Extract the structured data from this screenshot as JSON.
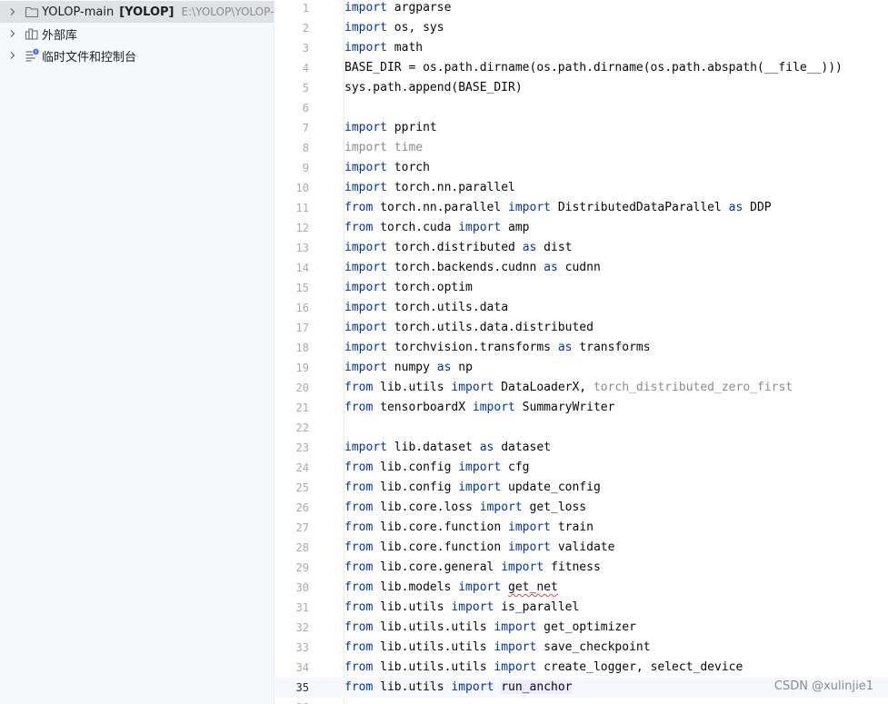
{
  "tree": {
    "items": [
      {
        "label": "YOLOP-main",
        "module": "[YOLOP]",
        "path": "E:\\YOLOP\\YOLOP-main",
        "icon": "folder-icon"
      },
      {
        "label": "外部库",
        "icon": "library-icon"
      },
      {
        "label": "临时文件和控制台",
        "icon": "scratches-icon"
      }
    ]
  },
  "editor": {
    "current_line": 35,
    "lines": [
      [
        [
          "kw",
          "import"
        ],
        [
          "t",
          " argparse"
        ]
      ],
      [
        [
          "kw",
          "import"
        ],
        [
          "t",
          " os, sys"
        ]
      ],
      [
        [
          "kw",
          "import"
        ],
        [
          "t",
          " math"
        ]
      ],
      [
        [
          "t",
          "BASE_DIR = os.path.dirname(os.path.dirname(os.path.abspath(__file__)))"
        ]
      ],
      [
        [
          "t",
          "sys.path.append(BASE_DIR)"
        ]
      ],
      [],
      [
        [
          "kw",
          "import"
        ],
        [
          "t",
          " pprint"
        ]
      ],
      [
        [
          "dim",
          "import time"
        ]
      ],
      [
        [
          "kw",
          "import"
        ],
        [
          "t",
          " torch"
        ]
      ],
      [
        [
          "kw",
          "import"
        ],
        [
          "t",
          " torch.nn.parallel"
        ]
      ],
      [
        [
          "kw",
          "from"
        ],
        [
          "t",
          " torch.nn.parallel "
        ],
        [
          "kw",
          "import"
        ],
        [
          "t",
          " DistributedDataParallel "
        ],
        [
          "kw",
          "as"
        ],
        [
          "t",
          " DDP"
        ]
      ],
      [
        [
          "kw",
          "from"
        ],
        [
          "t",
          " torch.cuda "
        ],
        [
          "kw",
          "import"
        ],
        [
          "t",
          " amp"
        ]
      ],
      [
        [
          "kw",
          "import"
        ],
        [
          "t",
          " torch.distributed "
        ],
        [
          "kw",
          "as"
        ],
        [
          "t",
          " dist"
        ]
      ],
      [
        [
          "kw",
          "import"
        ],
        [
          "t",
          " torch.backends.cudnn "
        ],
        [
          "kw",
          "as"
        ],
        [
          "t",
          " cudnn"
        ]
      ],
      [
        [
          "kw",
          "import"
        ],
        [
          "t",
          " torch.optim"
        ]
      ],
      [
        [
          "kw",
          "import"
        ],
        [
          "t",
          " torch.utils.data"
        ]
      ],
      [
        [
          "kw",
          "import"
        ],
        [
          "t",
          " torch.utils.data.distributed"
        ]
      ],
      [
        [
          "kw",
          "import"
        ],
        [
          "t",
          " torchvision.transforms "
        ],
        [
          "kw",
          "as"
        ],
        [
          "t",
          " transforms"
        ]
      ],
      [
        [
          "kw",
          "import"
        ],
        [
          "t",
          " numpy "
        ],
        [
          "kw",
          "as"
        ],
        [
          "t",
          " np"
        ]
      ],
      [
        [
          "kw",
          "from"
        ],
        [
          "t",
          " lib.utils "
        ],
        [
          "kw",
          "import"
        ],
        [
          "t",
          " DataLoaderX, "
        ],
        [
          "dim",
          "torch_distributed_zero_first"
        ]
      ],
      [
        [
          "kw",
          "from"
        ],
        [
          "t",
          " tensorboardX "
        ],
        [
          "kw",
          "import"
        ],
        [
          "t",
          " SummaryWriter"
        ]
      ],
      [],
      [
        [
          "kw",
          "import"
        ],
        [
          "t",
          " lib.dataset "
        ],
        [
          "kw",
          "as"
        ],
        [
          "t",
          " dataset"
        ]
      ],
      [
        [
          "kw",
          "from"
        ],
        [
          "t",
          " lib.config "
        ],
        [
          "kw",
          "import"
        ],
        [
          "t",
          " cfg"
        ]
      ],
      [
        [
          "kw",
          "from"
        ],
        [
          "t",
          " lib.config "
        ],
        [
          "kw",
          "import"
        ],
        [
          "t",
          " update_config"
        ]
      ],
      [
        [
          "kw",
          "from"
        ],
        [
          "t",
          " lib.core.loss "
        ],
        [
          "kw",
          "import"
        ],
        [
          "t",
          " get_loss"
        ]
      ],
      [
        [
          "kw",
          "from"
        ],
        [
          "t",
          " lib.core.function "
        ],
        [
          "kw",
          "import"
        ],
        [
          "t",
          " train"
        ]
      ],
      [
        [
          "kw",
          "from"
        ],
        [
          "t",
          " lib.core.function "
        ],
        [
          "kw",
          "import"
        ],
        [
          "t",
          " validate"
        ]
      ],
      [
        [
          "kw",
          "from"
        ],
        [
          "t",
          " lib.core.general "
        ],
        [
          "kw",
          "import"
        ],
        [
          "t",
          " fitness"
        ]
      ],
      [
        [
          "kw",
          "from"
        ],
        [
          "t",
          " lib.models "
        ],
        [
          "kw",
          "import"
        ],
        [
          "t",
          " "
        ],
        [
          "squig",
          "get_net"
        ]
      ],
      [
        [
          "kw",
          "from"
        ],
        [
          "t",
          " lib.utils "
        ],
        [
          "kw",
          "import"
        ],
        [
          "t",
          " is_parallel"
        ]
      ],
      [
        [
          "kw",
          "from"
        ],
        [
          "t",
          " lib.utils.utils "
        ],
        [
          "kw",
          "import"
        ],
        [
          "t",
          " get_optimizer"
        ]
      ],
      [
        [
          "kw",
          "from"
        ],
        [
          "t",
          " lib.utils.utils "
        ],
        [
          "kw",
          "import"
        ],
        [
          "t",
          " save_checkpoint"
        ]
      ],
      [
        [
          "kw",
          "from"
        ],
        [
          "t",
          " lib.utils.utils "
        ],
        [
          "kw",
          "import"
        ],
        [
          "t",
          " create_logger, select_device"
        ]
      ],
      [
        [
          "kw",
          "from"
        ],
        [
          "t",
          " lib.utils "
        ],
        [
          "kw",
          "import"
        ],
        [
          "t",
          " "
        ],
        [
          "hl",
          "run_anchor"
        ]
      ],
      []
    ]
  },
  "watermark": "CSDN @xulinjie1"
}
